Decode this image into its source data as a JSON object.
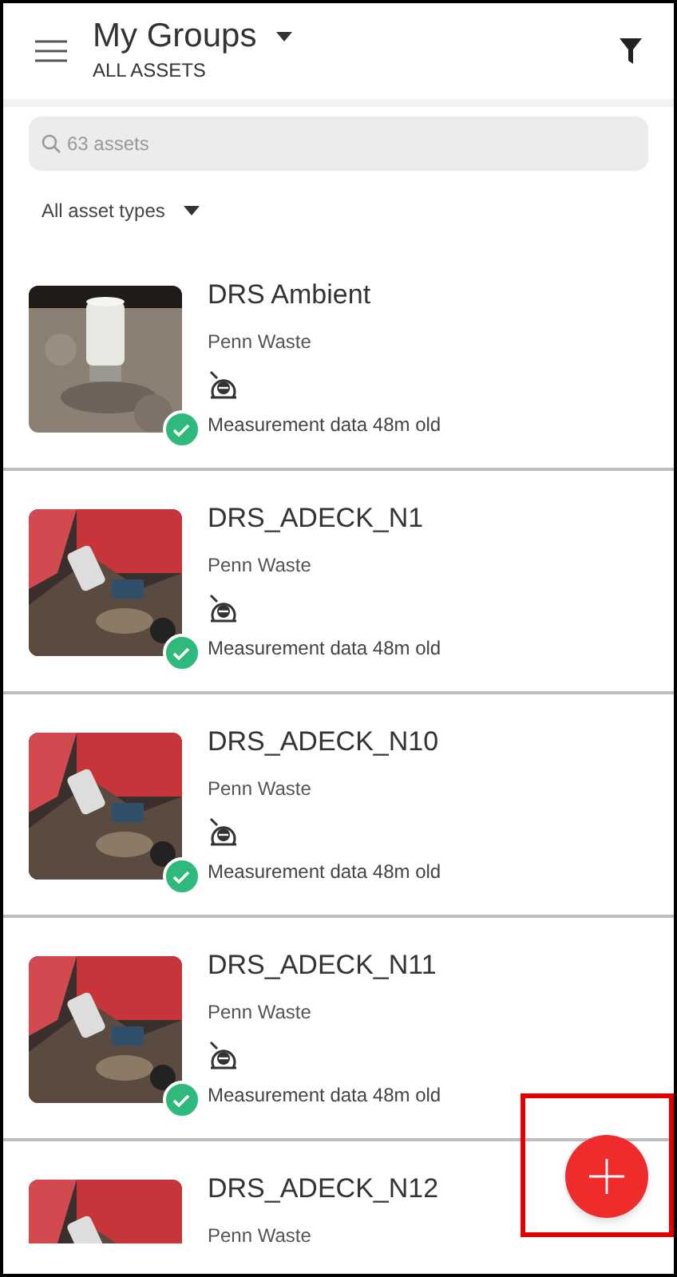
{
  "header": {
    "title": "My Groups",
    "subtitle": "ALL ASSETS"
  },
  "search": {
    "placeholder": "63 assets"
  },
  "type_filter": {
    "label": "All asset types"
  },
  "assets": [
    {
      "name": "DRS Ambient",
      "owner": "Penn Waste",
      "sensor": true,
      "status": "Measurement data 48m old",
      "ok": true
    },
    {
      "name": "DRS_ADECK_N1",
      "owner": "Penn Waste",
      "sensor": true,
      "status": "Measurement data 48m old",
      "ok": true
    },
    {
      "name": "DRS_ADECK_N10",
      "owner": "Penn Waste",
      "sensor": true,
      "status": "Measurement data 48m old",
      "ok": true
    },
    {
      "name": "DRS_ADECK_N11",
      "owner": "Penn Waste",
      "sensor": true,
      "status": "Measurement data 48m old",
      "ok": true
    },
    {
      "name": "DRS_ADECK_N12",
      "owner": "Penn Waste"
    }
  ],
  "highlight": {
    "shown": true
  }
}
